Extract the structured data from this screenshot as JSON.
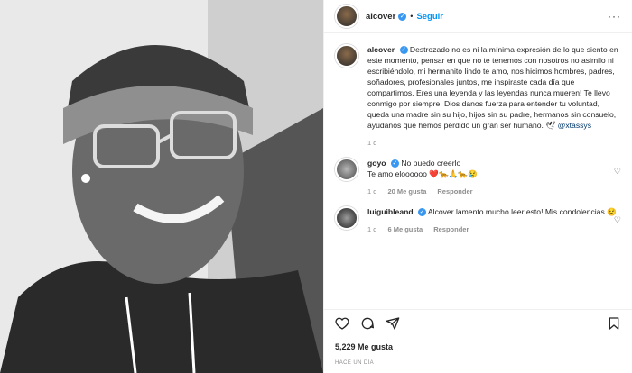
{
  "post": {
    "author": "alcover",
    "follow_label": "Seguir",
    "dot": "•",
    "more": "···",
    "caption_user": "alcover",
    "caption": "Destrozado no es ni la mínima expresión de lo que siento en este momento, pensar en que no te tenemos con nosotros no asimilo ni escribiéndolo, mi hermanito lindo te amo, nos hicimos hombres, padres, soñadores, profesionales juntos, me inspiraste cada día que compartimos. Eres una leyenda y las leyendas nunca mueren! Te llevo conmigo por siempre. Dios danos fuerza para entender tu voluntad, queda una madre sin su hijo, hijos sin su padre, hermanos sin consuelo, ayúdanos que hemos perdido un gran ser humano. 🕊",
    "caption_mention": "@xtassys",
    "caption_time": "1 d"
  },
  "comments": [
    {
      "user": "goyo",
      "text": "No puedo creerlo",
      "text2": "Te amo eloooooo ❤️🐆🙏🐆😢",
      "time": "1 d",
      "likes": "20 Me gusta",
      "reply": "Responder"
    },
    {
      "user": "luiguibleand",
      "text": "Alcover lamento mucho leer esto! Mis condolencias 😢",
      "text2": "",
      "time": "1 d",
      "likes": "6 Me gusta",
      "reply": "Responder"
    }
  ],
  "footer": {
    "likes": "5,229 Me gusta",
    "ago": "HACE UN DÍA"
  },
  "icons": {
    "verified": "verified-badge-icon",
    "like": "heart-icon",
    "comment": "comment-icon",
    "share": "share-icon",
    "save": "bookmark-icon"
  }
}
